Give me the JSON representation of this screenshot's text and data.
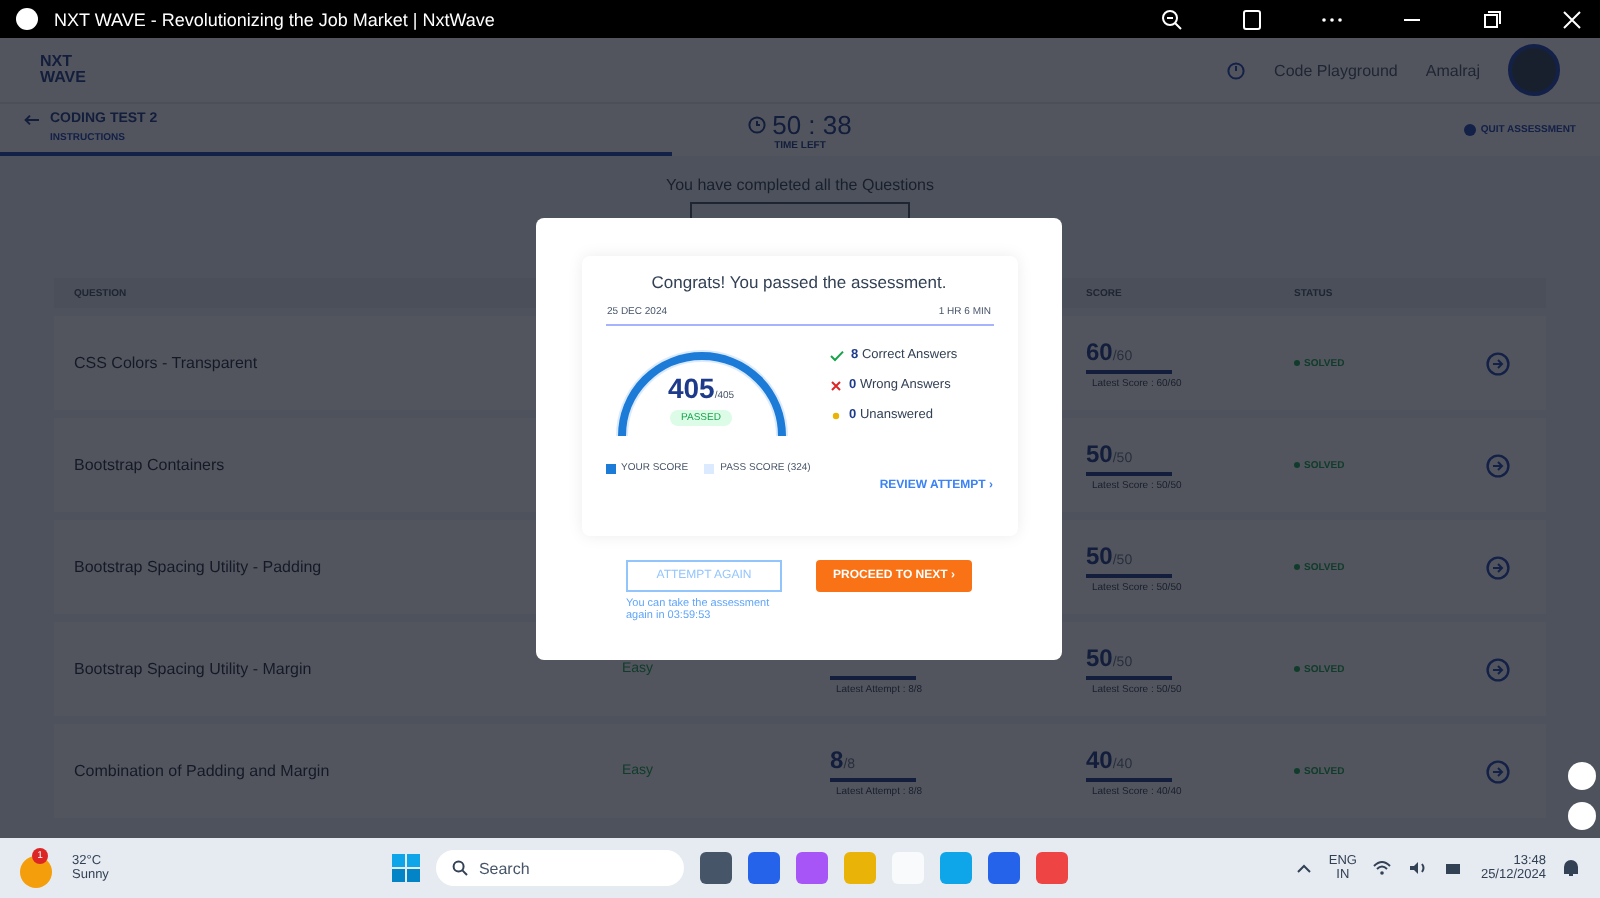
{
  "window": {
    "title": "NXT WAVE - Revolutionizing the Job Market | NxtWave"
  },
  "header": {
    "logo_top": "NXT",
    "logo_bottom": "WAVE",
    "links": [
      "Code Playground",
      "Amalraj"
    ]
  },
  "test_bar": {
    "title": "CODING TEST 2",
    "instructions": "INSTRUCTIONS",
    "timer": "50 : 38",
    "timer_label": "TIME LEFT",
    "quit": "QUIT ASSESSMENT"
  },
  "message": "You have completed all the Questions",
  "table": {
    "columns": [
      "QUESTION",
      null,
      null,
      "SCORE",
      "STATUS"
    ],
    "rows": [
      {
        "question": "CSS Colors - Transparent",
        "difficulty": null,
        "attempt": null,
        "score": {
          "value": "60",
          "total": "/60",
          "caption": "Latest Score : 60/60",
          "level": 1
        },
        "status": "SOLVED"
      },
      {
        "question": "Bootstrap Containers",
        "difficulty": null,
        "attempt": null,
        "score": {
          "value": "50",
          "total": "/50",
          "caption": "Latest Score : 50/50",
          "level": 1
        },
        "status": "SOLVED"
      },
      {
        "question": "Bootstrap Spacing Utility - Padding",
        "difficulty": null,
        "attempt": null,
        "score": {
          "value": "50",
          "total": "/50",
          "caption": "Latest Score : 50/50",
          "level": 1
        },
        "status": "SOLVED"
      },
      {
        "question": "Bootstrap Spacing Utility - Margin",
        "difficulty": "Easy",
        "attempt": {
          "caption": "Latest Attempt : 8/8",
          "level": 1
        },
        "score": {
          "value": "50",
          "total": "/50",
          "caption": "Latest Score : 50/50",
          "level": 1
        },
        "status": "SOLVED"
      },
      {
        "question": "Combination of Padding and Margin",
        "difficulty": "Easy",
        "attempt": {
          "value": "8",
          "total": "/8",
          "caption": "Latest Attempt : 8/8",
          "level": 1
        },
        "score": {
          "value": "40",
          "total": "/40",
          "caption": "Latest Score : 40/40",
          "level": 1
        },
        "status": "SOLVED"
      }
    ]
  },
  "modal": {
    "title": "Congrats! You passed the assessment.",
    "date": "25 DEC 2024",
    "duration": "1 HR 6 MIN",
    "gauge": {
      "score": "405",
      "total": "/405",
      "badge": "PASSED",
      "level": 1
    },
    "stats": [
      {
        "kind": "correct",
        "count": "8",
        "label": "Correct Answers"
      },
      {
        "kind": "wrong",
        "count": "0",
        "label": "Wrong Answers"
      },
      {
        "kind": "unanswered",
        "count": "0",
        "label": "Unanswered"
      }
    ],
    "legend": [
      "YOUR SCORE",
      "PASS SCORE (324)"
    ],
    "review": "REVIEW ATTEMPT",
    "review_chevron": "›",
    "attempt_again": {
      "label": "ATTEMPT AGAIN",
      "disabled": true
    },
    "proceed": "PROCEED TO NEXT",
    "proceed_chevron": "›",
    "note": "You can take the assessment again in 03:59:53"
  },
  "taskbar": {
    "weather_badge": "1",
    "temperature": "32°C",
    "weather": "Sunny",
    "search_placeholder": "Search",
    "language": "ENG",
    "region": "IN",
    "time": "13:48",
    "date": "25/12/2024"
  }
}
